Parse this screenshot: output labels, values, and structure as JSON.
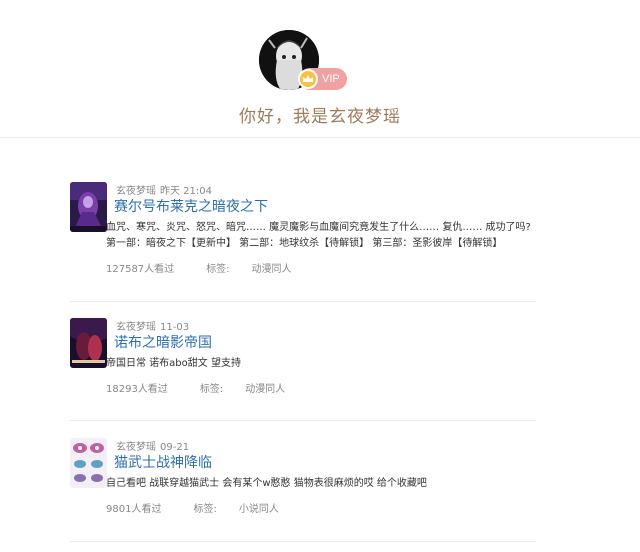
{
  "profile": {
    "name_greeting": "你好，我是玄夜梦瑶",
    "vip_label": "VIP",
    "avatar_icon": "avatar-illustration",
    "vip_icon": "crown-icon"
  },
  "posts": [
    {
      "author": "玄夜梦瑶",
      "date": "昨天 21:04",
      "title": "赛尔号布莱克之暗夜之下",
      "desc_line1": "血咒、寒咒、炎咒、怒咒、暗咒…… 魔灵魔影与血魔间究竟发生了什么…… 复仇…… 成功了吗?",
      "desc_line2": "第一部：暗夜之下【更新中】 第二部：地球纹杀【待解锁】 第三部：圣影彼岸【待解锁】",
      "views": "127587人看过",
      "tag_label": "标签:",
      "tag": "动漫同人",
      "thumb_colors": [
        "#2a1a4a",
        "#7b3fa8",
        "#c8a0e8"
      ]
    },
    {
      "author": "玄夜梦瑶",
      "date": "11-03",
      "title": "诺布之暗影帝国",
      "desc_line1": "帝国日常 诺布abo甜文 望支持",
      "desc_line2": "",
      "views": "18293人看过",
      "tag_label": "标签:",
      "tag": "动漫同人",
      "thumb_colors": [
        "#1a0f2a",
        "#6a1a3a",
        "#b03050"
      ]
    },
    {
      "author": "玄夜梦瑶",
      "date": "09-21",
      "title": "猫武士战神降临",
      "desc_line1": "自己看吧 战联穿越猫武士 会有某个w憨憨 猫物表很麻烦的哎 给个收藏吧",
      "desc_line2": "",
      "views": "9801人看过",
      "tag_label": "标签:",
      "tag": "小说同人",
      "thumb_colors": [
        "#d8c8e0",
        "#c060a0",
        "#60a0c0"
      ]
    }
  ],
  "colors": {
    "title_link": "#2f6fb0",
    "greeting": "#9b7b5a",
    "vip_pill": "#f0a1a1",
    "crown": "#f7c343"
  }
}
